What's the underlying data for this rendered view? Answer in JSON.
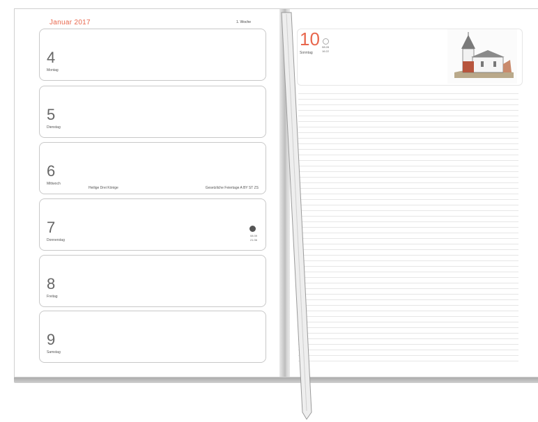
{
  "left_page": {
    "month_title": "Januar 2017",
    "week_label": "1. Woche",
    "days": [
      {
        "num": "4",
        "name": "Montag"
      },
      {
        "num": "5",
        "name": "Dienstag"
      },
      {
        "num": "6",
        "name": "Mittwoch",
        "note_left": "Heilige Drei Könige",
        "note_right": "Gesetzliche Feiertage A BY ST ZS"
      },
      {
        "num": "7",
        "name": "Donnerstag",
        "moon_rise": "08:39",
        "moon_set": "21:36"
      },
      {
        "num": "8",
        "name": "Freitag"
      },
      {
        "num": "9",
        "name": "Samstag"
      }
    ]
  },
  "right_page": {
    "day_num": "10",
    "day_name": "Sonntag",
    "sunrise": "08:28",
    "sunset": "16:22",
    "image": "church-illustration"
  },
  "colors": {
    "accent": "#e8674d",
    "page": "#ffffff",
    "box_border": "#c8c8c8"
  }
}
